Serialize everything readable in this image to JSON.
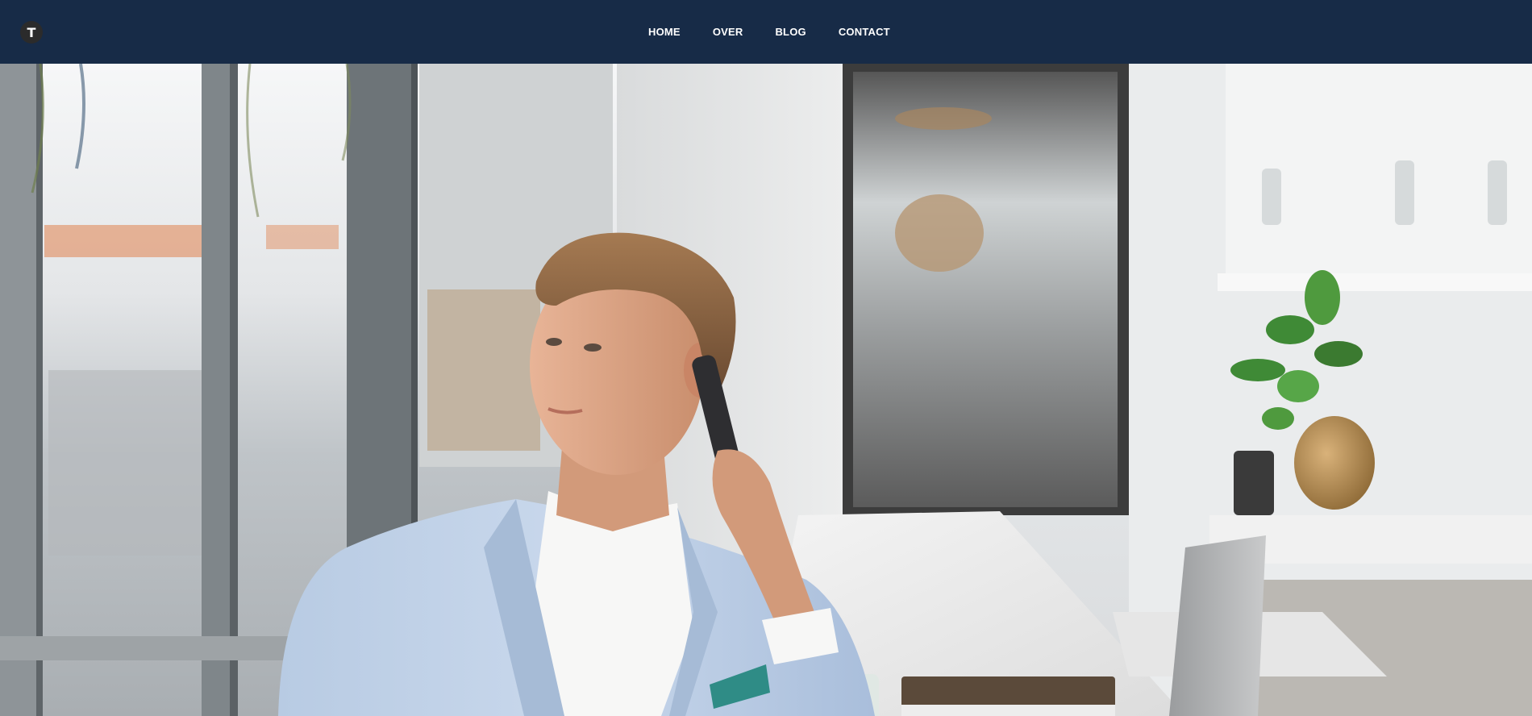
{
  "header": {
    "logo_letter": "T",
    "logo_icon": "logo-icon",
    "background_color": "#172b47"
  },
  "nav": {
    "items": [
      {
        "label": "HOME"
      },
      {
        "label": "OVER"
      },
      {
        "label": "BLOG"
      },
      {
        "label": "CONTACT"
      }
    ]
  },
  "hero": {
    "image": "man-on-phone-in-bright-cafe"
  }
}
